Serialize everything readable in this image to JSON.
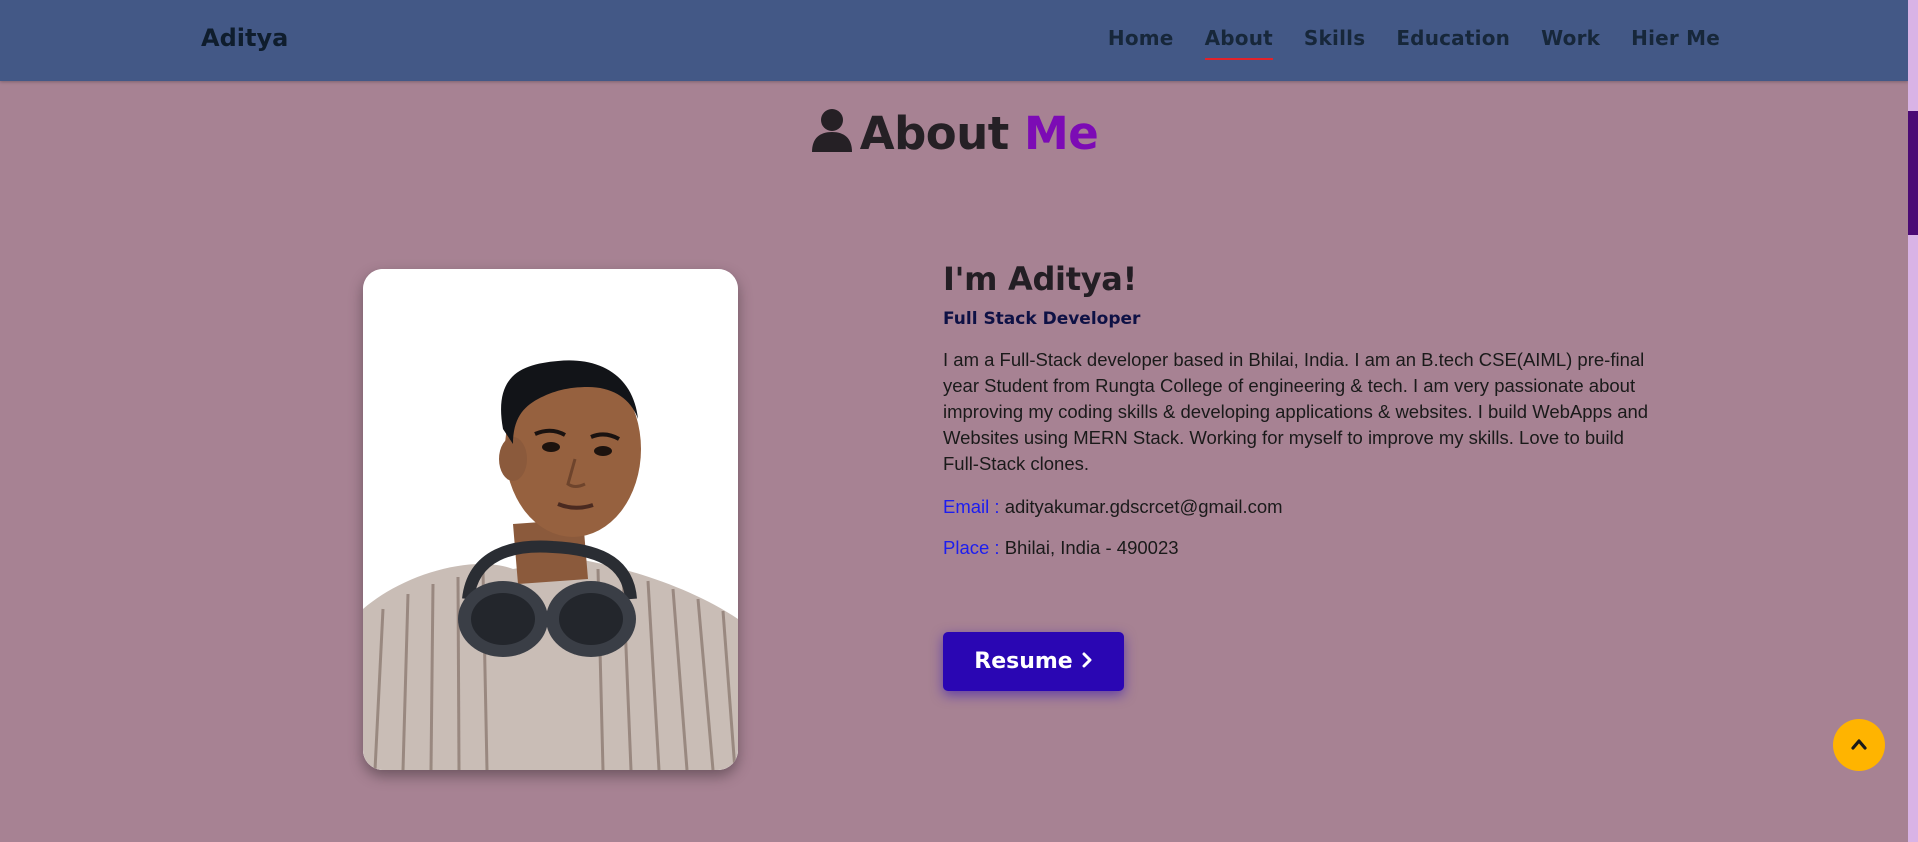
{
  "header": {
    "logo": "Aditya",
    "nav": [
      {
        "label": "Home"
      },
      {
        "label": "About"
      },
      {
        "label": "Skills"
      },
      {
        "label": "Education"
      },
      {
        "label": "Work"
      },
      {
        "label": "Hier Me"
      }
    ],
    "active_nav": "About"
  },
  "section": {
    "title_main": "About",
    "title_accent": "Me",
    "icon": "user-icon"
  },
  "about": {
    "greeting": "I'm Aditya!",
    "role": "Full Stack Developer",
    "bio": "I am a Full-Stack developer based in Bhilai, India. I am an B.tech CSE(AIML) pre-final year Student from Rungta College of engineering & tech. I am very passionate about improving my coding skills & developing applications & websites. I build WebApps and Websites using MERN Stack. Working for myself to improve my skills. Love to build Full-Stack clones.",
    "email_label": "Email :",
    "email_value": "adityakumar.gdscrcet@gmail.com",
    "place_label": "Place :",
    "place_value": "Bhilai, India - 490023",
    "resume_label": "Resume"
  },
  "colors": {
    "page_bg": "#a78293",
    "header_bg": "#435886",
    "accent": "#7c0bb5",
    "resume_button": "#2a06b3",
    "scroll_top_button": "#ffb400",
    "label_blue": "#1d1df0",
    "nav_underline": "#e2222a"
  },
  "icons": {
    "resume": "chevron-right-icon",
    "scroll_top": "chevron-up-icon"
  }
}
